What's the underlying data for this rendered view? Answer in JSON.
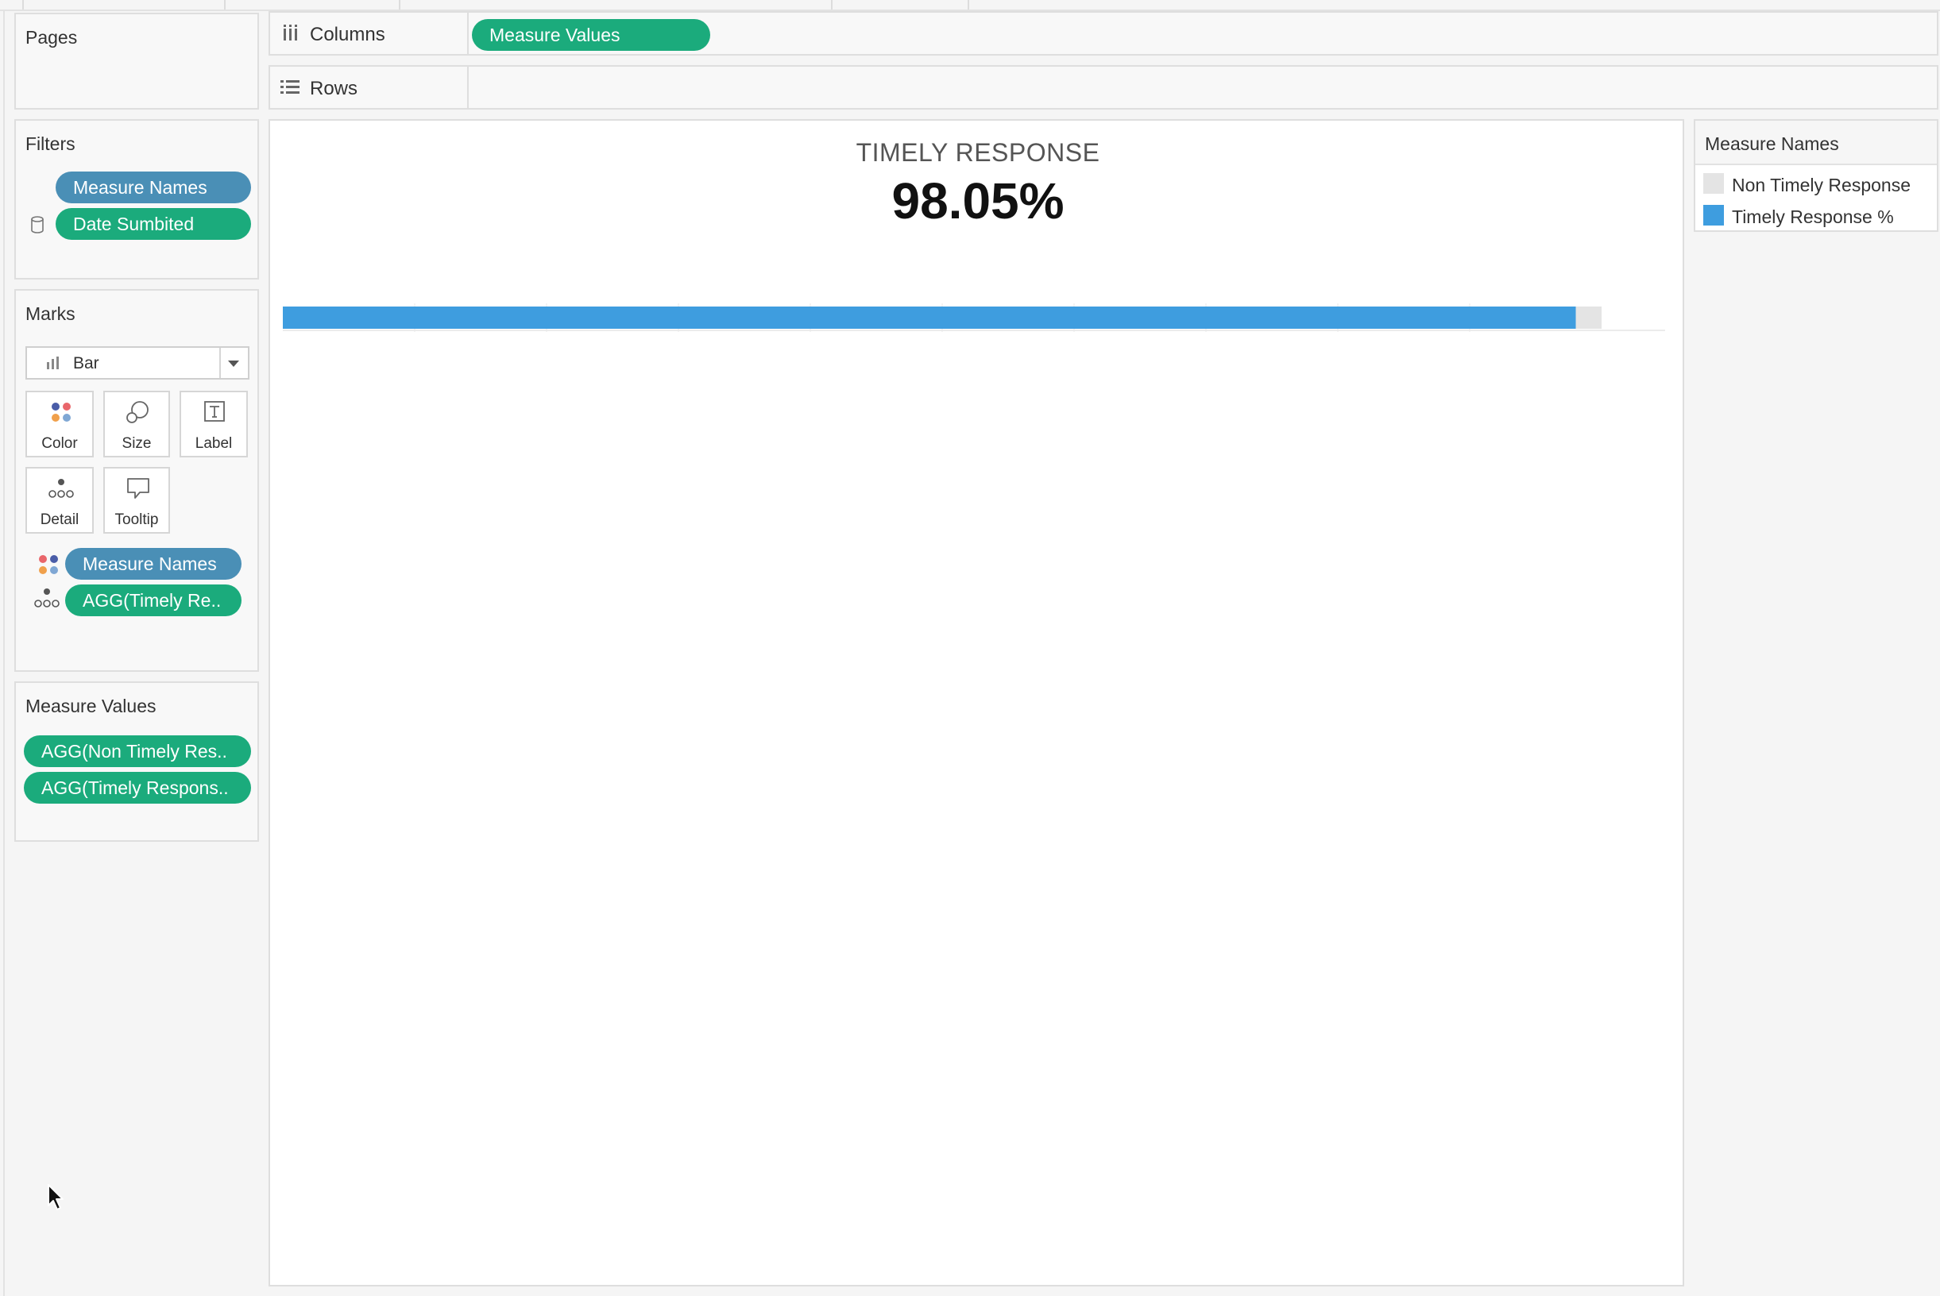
{
  "pages": {
    "title": "Pages"
  },
  "columns_shelf": {
    "label": "Columns",
    "pill": "Measure Values"
  },
  "rows_shelf": {
    "label": "Rows"
  },
  "filters": {
    "title": "Filters",
    "items": [
      "Measure Names",
      "Date Sumbited"
    ]
  },
  "marks": {
    "title": "Marks",
    "mark_type": "Bar",
    "buttons": {
      "color": "Color",
      "size": "Size",
      "label": "Label",
      "detail": "Detail",
      "tooltip": "Tooltip"
    },
    "fields": [
      "Measure Names",
      "AGG(Timely Re.."
    ]
  },
  "measure_values": {
    "title": "Measure Values",
    "items": [
      "AGG(Non Timely Res..",
      "AGG(Timely Respons.."
    ]
  },
  "view": {
    "title": "TIMELY RESPONSE",
    "kpi": "98.05%"
  },
  "legend": {
    "title": "Measure Names",
    "items": [
      {
        "label": "Non Timely Response",
        "color": "#e4e4e4"
      },
      {
        "label": "Timely Response %",
        "color": "#3e9ddf"
      }
    ]
  },
  "chart_data": {
    "type": "bar",
    "orientation": "horizontal",
    "stacked": true,
    "series": [
      {
        "name": "Timely Response %",
        "values": [
          98.05
        ],
        "color": "#3e9ddf"
      },
      {
        "name": "Non Timely Response",
        "values": [
          1.95
        ],
        "color": "#e4e4e4"
      }
    ],
    "xlim": [
      0,
      100
    ]
  },
  "colors": {
    "pill_dimension": "#4a8fb6",
    "pill_measure": "#1bab7c"
  }
}
